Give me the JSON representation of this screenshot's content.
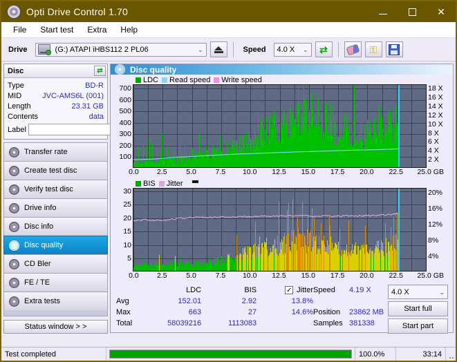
{
  "window": {
    "title": "Opti Drive Control 1.70",
    "icon": "disc-icon",
    "minimize": "—",
    "maximize": "□",
    "close": "✕"
  },
  "menu": {
    "items": [
      "File",
      "Start test",
      "Extra",
      "Help"
    ]
  },
  "toolbar": {
    "drive_label": "Drive",
    "drive_value": "(G:)  ATAPI iHBS112  2 PL06",
    "eject_icon": "eject-icon",
    "speed_label": "Speed",
    "speed_value": "4.0 X",
    "refresh_icon": "refresh-arrows-icon",
    "erase_icon": "eraser-icon",
    "key_icon": "key-icon",
    "save_icon": "save-floppy-icon"
  },
  "disc_panel": {
    "title": "Disc",
    "refresh_icon": "refresh-arrows-icon",
    "rows": [
      {
        "key": "Type",
        "value": "BD-R"
      },
      {
        "key": "MID",
        "value": "JVC-AMS6L (001)"
      },
      {
        "key": "Length",
        "value": "23.31 GB"
      },
      {
        "key": "Contents",
        "value": "data"
      }
    ],
    "label_key": "Label",
    "label_value": "",
    "label_placeholder": "",
    "disc_button_icon": "cd-disc-icon"
  },
  "sidebar": {
    "items": [
      {
        "label": "Transfer rate",
        "icon": "disc-icon",
        "active": false
      },
      {
        "label": "Create test disc",
        "icon": "disc-icon",
        "active": false
      },
      {
        "label": "Verify test disc",
        "icon": "disc-icon",
        "active": false
      },
      {
        "label": "Drive info",
        "icon": "disc-icon",
        "active": false
      },
      {
        "label": "Disc info",
        "icon": "disc-icon",
        "active": false
      },
      {
        "label": "Disc quality",
        "icon": "disc-icon",
        "active": true
      },
      {
        "label": "CD Bler",
        "icon": "disc-icon",
        "active": false
      },
      {
        "label": "FE / TE",
        "icon": "disc-icon",
        "active": false
      },
      {
        "label": "Extra tests",
        "icon": "disc-icon",
        "active": false
      }
    ],
    "status_window_button": "Status window > >"
  },
  "main": {
    "header": "Disc quality",
    "header_icon": "disc-icon"
  },
  "stats": {
    "col_headers": [
      "",
      "LDC",
      "BIS"
    ],
    "jitter_checkbox_checked": true,
    "jitter_label": "Jitter",
    "jitter_check_glyph": "✓",
    "rows": [
      {
        "label": "Avg",
        "ldc": "152.01",
        "bis": "2.92",
        "jitter": "13.8%"
      },
      {
        "label": "Max",
        "ldc": "663",
        "bis": "27",
        "jitter": "14.6%"
      },
      {
        "label": "Total",
        "ldc": "58039216",
        "bis": "1113083",
        "jitter": ""
      }
    ],
    "speed_label": "Speed",
    "speed_value": "4.19 X",
    "speed_select": "4.0 X",
    "position_label": "Position",
    "position_value": "23862 MB",
    "samples_label": "Samples",
    "samples_value": "381338",
    "start_full_button": "Start full",
    "start_part_button": "Start part"
  },
  "statusbar": {
    "message": "Test completed",
    "progress_pct": "100.0%",
    "progress_value": 100,
    "elapsed": "33:14"
  },
  "colors": {
    "title_bar": "#6b5600",
    "ldc_green": "#00c000",
    "read_speed_cyan": "#86d9f0",
    "write_speed_pink": "#f58fdc",
    "bis_green": "#00c000",
    "jitter_pink": "#d8a8d8",
    "plot_bg": "#5f6b85",
    "accent_blue": "#2b2bc0",
    "progress_green": "#00a400",
    "active_nav": "#0a82c8",
    "cursor_cyan": "#2ad2f5"
  },
  "chart_data": [
    {
      "type": "area",
      "name": "disc-quality-ldc",
      "title": "",
      "legend": [
        {
          "label": "LDC",
          "color": "#00a800"
        },
        {
          "label": "Read speed",
          "color": "#86d9f0"
        },
        {
          "label": "Write speed",
          "color": "#f58fdc"
        }
      ],
      "legend_position": "top-left",
      "xlabel": "GB",
      "x_ticks": [
        "0.0",
        "2.5",
        "5.0",
        "7.5",
        "10.0",
        "12.5",
        "15.0",
        "17.5",
        "20.0",
        "22.5",
        "25.0 GB"
      ],
      "xlim": [
        0,
        25
      ],
      "ylabel_left": "LDC",
      "y_ticks_left": [
        "100",
        "200",
        "300",
        "400",
        "500",
        "600",
        "700"
      ],
      "ylim_left": [
        0,
        730
      ],
      "ylabel_right": "Speed",
      "y_ticks_right": [
        "2 X",
        "4 X",
        "6 X",
        "8 X",
        "10 X",
        "12 X",
        "14 X",
        "16 X",
        "18 X"
      ],
      "ylim_right": [
        0,
        18.8
      ],
      "grid": true,
      "data_end_gb": 22.63,
      "series": [
        {
          "name": "LDC",
          "color": "#00c000",
          "style": "bars",
          "x": [
            0.0,
            0.3,
            0.6,
            0.9,
            1.2,
            1.5,
            1.8,
            2.1,
            2.4,
            2.7,
            3.0,
            3.3,
            3.6,
            3.9,
            4.2,
            4.5,
            4.8,
            5.1,
            5.4,
            5.7,
            6.0,
            6.3,
            6.6,
            6.9,
            7.2,
            7.5,
            7.8,
            8.1,
            8.4,
            8.7,
            9.0,
            9.3,
            9.6,
            9.9,
            10.2,
            10.5,
            10.8,
            11.1,
            11.4,
            11.7,
            12.0,
            12.3,
            12.6,
            12.9,
            13.2,
            13.5,
            13.8,
            14.1,
            14.4,
            14.7,
            15.0,
            15.3,
            15.6,
            15.9,
            16.2,
            16.5,
            16.8,
            17.1,
            17.4,
            17.7,
            18.0,
            18.3,
            18.6,
            18.9,
            19.2,
            19.5,
            19.8,
            20.1,
            20.4,
            20.7,
            21.0,
            21.3,
            21.6,
            21.9,
            22.2,
            22.5
          ],
          "values": [
            46,
            50,
            48,
            52,
            55,
            58,
            60,
            57,
            62,
            65,
            68,
            70,
            72,
            75,
            78,
            82,
            85,
            90,
            95,
            100,
            108,
            115,
            120,
            128,
            135,
            142,
            150,
            160,
            170,
            180,
            195,
            210,
            225,
            240,
            258,
            275,
            292,
            310,
            330,
            350,
            368,
            385,
            398,
            410,
            420,
            428,
            432,
            438,
            440,
            442,
            438,
            430,
            420,
            408,
            398,
            385,
            370,
            352,
            338,
            325,
            312,
            300,
            292,
            285,
            280,
            278,
            282,
            290,
            300,
            312,
            325,
            340,
            358,
            378,
            400,
            430
          ]
        },
        {
          "name": "LDC peaks",
          "color": "#00c000",
          "style": "spikes",
          "x": [
            0.4,
            0.8,
            1.1,
            1.35,
            1.6,
            2.0,
            2.4,
            2.9,
            3.4,
            3.9,
            4.4,
            5.0,
            5.6,
            6.2,
            6.8,
            7.4,
            8.0,
            8.6,
            9.2,
            9.8,
            10.4,
            11.0,
            11.6,
            12.2,
            12.8,
            13.4,
            14.0,
            14.6,
            15.2,
            15.8,
            16.4,
            17.0,
            17.6,
            18.2,
            18.8,
            19.4,
            20.0,
            20.6,
            21.2,
            21.8,
            22.4
          ],
          "values": [
            180,
            215,
            200,
            240,
            195,
            150,
            300,
            175,
            180,
            200,
            190,
            170,
            300,
            185,
            200,
            270,
            230,
            250,
            290,
            330,
            360,
            400,
            430,
            470,
            500,
            520,
            560,
            600,
            663,
            620,
            580,
            540,
            500,
            480,
            460,
            430,
            420,
            440,
            460,
            480,
            520
          ]
        },
        {
          "name": "Read speed",
          "color": "#86d9f0",
          "style": "line",
          "axis": "right",
          "x": [
            0.0,
            1.0,
            2.0,
            3.0,
            4.0,
            5.0,
            6.0,
            7.0,
            8.0,
            9.0,
            10.0,
            11.0,
            12.0,
            13.0,
            14.0,
            15.0,
            16.0,
            17.0,
            18.0,
            19.0,
            20.0,
            21.0,
            22.0,
            22.6
          ],
          "values": [
            1.7,
            1.8,
            1.9,
            2.15,
            2.3,
            2.45,
            2.6,
            2.75,
            2.9,
            3.0,
            3.1,
            3.2,
            3.3,
            3.4,
            3.5,
            3.58,
            3.66,
            3.74,
            3.82,
            3.9,
            3.96,
            4.02,
            4.1,
            4.19
          ]
        }
      ]
    },
    {
      "type": "area",
      "name": "disc-quality-bis-jitter",
      "title": "",
      "legend": [
        {
          "label": "BIS",
          "color": "#00a800"
        },
        {
          "label": "Jitter",
          "color": "#d8a8d8"
        }
      ],
      "legend_position": "top-left",
      "xlabel": "GB",
      "x_ticks": [
        "0.0",
        "2.5",
        "5.0",
        "7.5",
        "10.0",
        "12.5",
        "15.0",
        "17.5",
        "20.0",
        "22.5",
        "25.0 GB"
      ],
      "xlim": [
        0,
        25
      ],
      "ylabel_left": "BIS",
      "y_ticks_left": [
        "5",
        "10",
        "15",
        "20",
        "25",
        "30"
      ],
      "ylim_left": [
        0,
        31
      ],
      "ylabel_right": "Jitter",
      "y_ticks_right": [
        "4%",
        "8%",
        "12%",
        "16%",
        "20%"
      ],
      "ylim_right": [
        0,
        21
      ],
      "grid": true,
      "data_end_gb": 22.63,
      "series": [
        {
          "name": "BIS",
          "color": "#00c000",
          "color_high": "#d8d000",
          "color_peak": "#e08a00",
          "style": "bars",
          "x": [
            0.0,
            0.3,
            0.6,
            0.9,
            1.2,
            1.5,
            1.8,
            2.1,
            2.4,
            2.7,
            3.0,
            3.3,
            3.6,
            3.9,
            4.2,
            4.5,
            4.8,
            5.1,
            5.4,
            5.7,
            6.0,
            6.3,
            6.6,
            6.9,
            7.2,
            7.5,
            7.8,
            8.1,
            8.4,
            8.7,
            9.0,
            9.3,
            9.6,
            9.9,
            10.2,
            10.5,
            10.8,
            11.1,
            11.4,
            11.7,
            12.0,
            12.3,
            12.6,
            12.9,
            13.2,
            13.5,
            13.8,
            14.1,
            14.4,
            14.7,
            15.0,
            15.3,
            15.6,
            15.9,
            16.2,
            16.5,
            16.8,
            17.1,
            17.4,
            17.7,
            18.0,
            18.3,
            18.6,
            18.9,
            19.2,
            19.5,
            19.8,
            20.1,
            20.4,
            20.7,
            21.0,
            21.3,
            21.6,
            21.9,
            22.2,
            22.5
          ],
          "values": [
            2.0,
            2.1,
            2.0,
            2.2,
            2.1,
            2.3,
            2.2,
            2.4,
            2.3,
            2.5,
            2.4,
            2.6,
            2.5,
            2.7,
            2.6,
            2.8,
            2.7,
            2.9,
            3.0,
            3.1,
            3.2,
            3.3,
            3.4,
            3.6,
            3.8,
            4.0,
            4.3,
            4.6,
            5.0,
            5.4,
            5.8,
            6.2,
            6.6,
            7.0,
            7.4,
            7.8,
            8.2,
            8.6,
            9.0,
            9.4,
            9.8,
            10.2,
            10.6,
            11.0,
            11.4,
            11.8,
            12.0,
            12.2,
            12.2,
            12.0,
            11.8,
            11.4,
            11.0,
            10.6,
            10.2,
            9.8,
            9.4,
            9.0,
            8.8,
            8.6,
            8.4,
            8.2,
            8.0,
            7.9,
            7.8,
            7.8,
            7.9,
            8.0,
            8.2,
            8.4,
            8.6,
            8.9,
            9.2,
            9.6,
            10.0,
            10.6
          ]
        },
        {
          "name": "BIS peaks",
          "color": "#e08a00",
          "style": "spikes",
          "x": [
            12.4,
            13.1,
            13.6,
            14.0,
            14.4,
            14.9,
            15.4,
            16.0,
            16.8,
            17.6,
            18.4,
            19.8,
            21.5,
            22.2,
            22.5
          ],
          "values": [
            19,
            23,
            27,
            20,
            26,
            21,
            20,
            18,
            17,
            16,
            19,
            17,
            18,
            20,
            22
          ]
        },
        {
          "name": "Jitter",
          "color": "#d8a8d8",
          "style": "line",
          "axis": "right",
          "x": [
            0.0,
            0.5,
            1.0,
            1.5,
            2.0,
            2.5,
            3.0,
            3.5,
            4.0,
            4.5,
            5.0,
            5.5,
            6.0,
            6.5,
            7.0,
            7.5,
            8.0,
            8.5,
            9.0,
            9.5,
            10.0,
            10.5,
            11.0,
            11.5,
            12.0,
            12.5,
            13.0,
            13.5,
            14.0,
            14.5,
            15.0,
            15.5,
            16.0,
            16.5,
            17.0,
            17.5,
            18.0,
            18.5,
            19.0,
            19.5,
            20.0,
            20.5,
            21.0,
            21.5,
            22.0,
            22.6
          ],
          "values": [
            12.7,
            12.9,
            13.1,
            12.9,
            13.0,
            12.9,
            13.0,
            13.2,
            13.4,
            13.5,
            13.6,
            13.7,
            13.7,
            13.6,
            13.7,
            13.8,
            13.7,
            13.8,
            13.8,
            13.9,
            13.8,
            13.9,
            13.9,
            14.0,
            13.9,
            14.0,
            14.0,
            14.1,
            14.0,
            14.1,
            14.0,
            13.9,
            14.0,
            14.0,
            13.9,
            14.0,
            14.0,
            14.1,
            14.0,
            14.0,
            14.1,
            14.1,
            14.2,
            14.3,
            14.4,
            14.6
          ]
        }
      ]
    }
  ]
}
